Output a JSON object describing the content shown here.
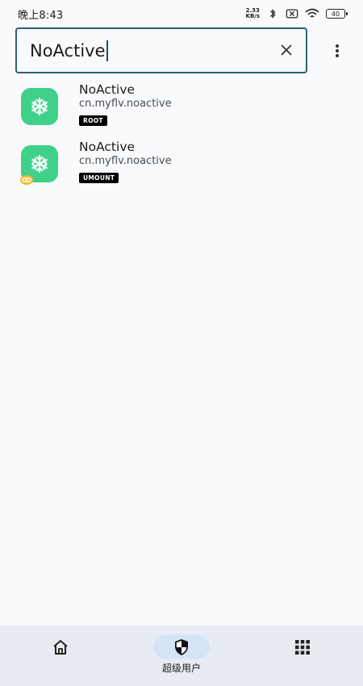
{
  "status_bar": {
    "time": "晚上8:43",
    "net_speed_value": "2.33",
    "net_speed_unit": "KB/s",
    "battery": "40"
  },
  "search": {
    "value": "NoActive"
  },
  "apps": [
    {
      "name": "NoActive",
      "package": "cn.myflv.noactive",
      "tag": "ROOT"
    },
    {
      "name": "NoActive",
      "package": "cn.myflv.noactive",
      "tag": "UMOUNT"
    }
  ],
  "bottom_nav": {
    "superuser_label": "超级用户"
  },
  "colors": {
    "accent": "#2f5f7a",
    "app_icon": "#3fd18a",
    "nav_active": "#d2e4f5"
  }
}
